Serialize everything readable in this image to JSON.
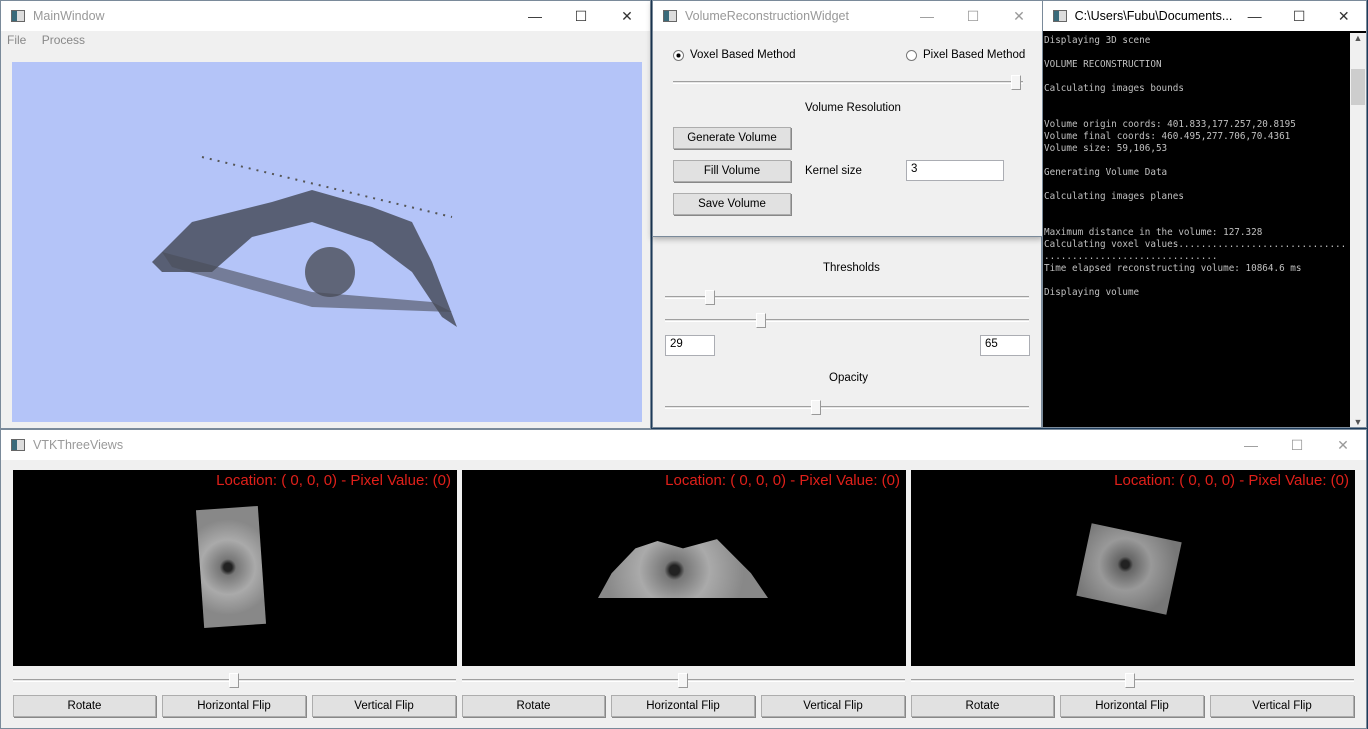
{
  "main_window": {
    "title": "MainWindow",
    "menu": [
      "File",
      "Process"
    ],
    "background": "#b4c4f8"
  },
  "volume_widget": {
    "title": "VolumeReconstructionWidget",
    "radio_voxel": "Voxel Based Method",
    "radio_pixel": "Pixel Based Method",
    "selected": "voxel",
    "resolution_label": "Volume Resolution",
    "resolution_slider": 1.0,
    "generate": "Generate Volume",
    "fill": "Fill Volume",
    "save": "Save Volume",
    "kernel_label": "Kernel size",
    "kernel_value": "3",
    "thresholds_label": "Thresholds",
    "threshold_low": "29",
    "threshold_high": "65",
    "opacity_label": "Opacity"
  },
  "console": {
    "title": "C:\\Users\\Fubu\\Documents...",
    "text": "Displaying 3D scene\n\nVOLUME RECONSTRUCTION\n\nCalculating images bounds\n\n\nVolume origin coords: 401.833,177.257,20.8195\nVolume final coords: 460.495,277.706,70.4361\nVolume size: 59,106,53\n\nGenerating Volume Data\n\nCalculating images planes\n\n\nMaximum distance in the volume: 127.328\nCalculating voxel values..............................\n...............................\nTime elapsed reconstructing volume: 10864.6 ms\n\nDisplaying volume"
  },
  "three_views": {
    "title": "VTKThreeViews",
    "views": [
      {
        "location": "Location: ( 0, 0, 0) - Pixel Value: (0)",
        "rotate": "Rotate",
        "hflip": "Horizontal Flip",
        "vflip": "Vertical Flip"
      },
      {
        "location": "Location: ( 0, 0, 0) - Pixel Value: (0)",
        "rotate": "Rotate",
        "hflip": "Horizontal Flip",
        "vflip": "Vertical Flip"
      },
      {
        "location": "Location: ( 0, 0, 0) - Pixel Value: (0)",
        "rotate": "Rotate",
        "hflip": "Horizontal Flip",
        "vflip": "Vertical Flip"
      }
    ]
  }
}
